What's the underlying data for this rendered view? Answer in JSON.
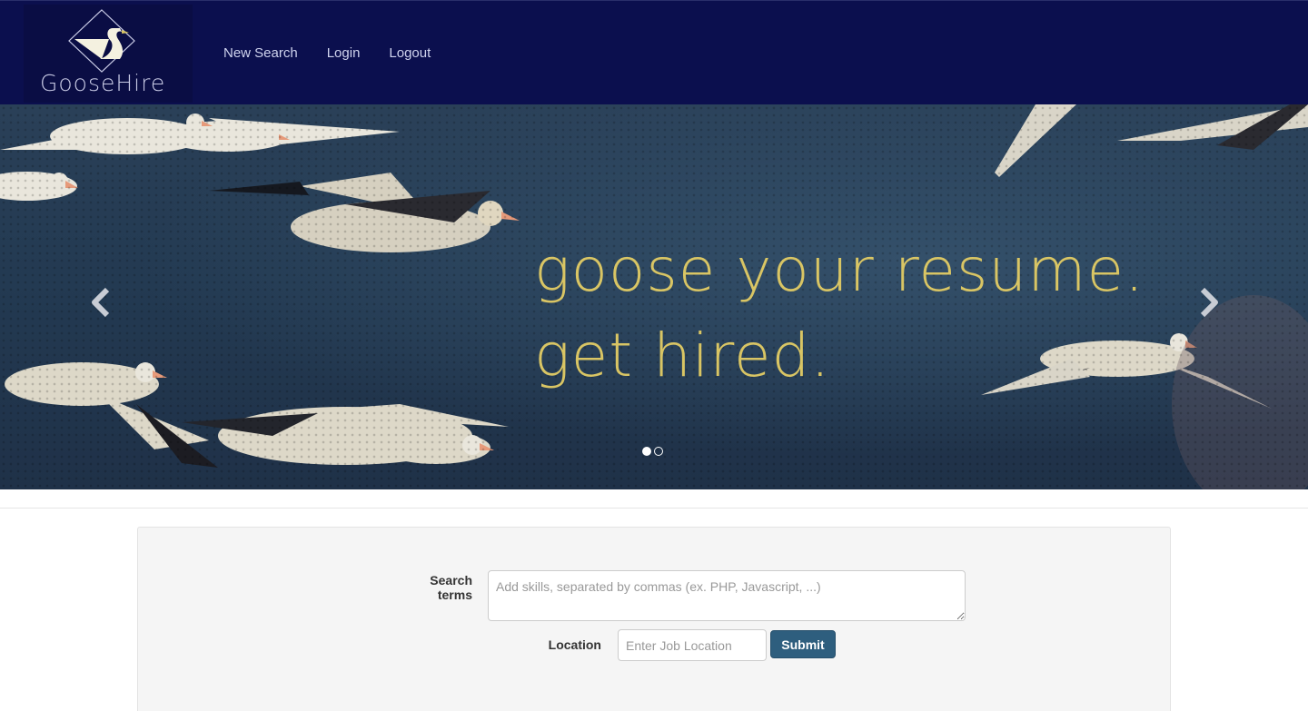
{
  "brand": {
    "name": "GooseHire",
    "logo_icon": "goose-diamond-logo-icon"
  },
  "nav": {
    "items": [
      {
        "label": "New Search"
      },
      {
        "label": "Login"
      },
      {
        "label": "Logout"
      }
    ]
  },
  "hero": {
    "headline_line1": "goose your resume.",
    "headline_line2": "get hired.",
    "prev_icon": "chevron-left-icon",
    "next_icon": "chevron-right-icon",
    "slide_count": 2,
    "active_slide": 1
  },
  "search": {
    "terms_label": "Search terms",
    "terms_placeholder": "Add skills, separated by commas (ex. PHP, Javascript, ...)",
    "terms_value": "",
    "location_label": "Location",
    "location_placeholder": "Enter Job Location",
    "location_value": "",
    "submit_label": "Submit"
  },
  "colors": {
    "navbar_bg": "#0b0f4e",
    "headline": "#d9c564",
    "submit_bg": "#2e5e7e"
  }
}
